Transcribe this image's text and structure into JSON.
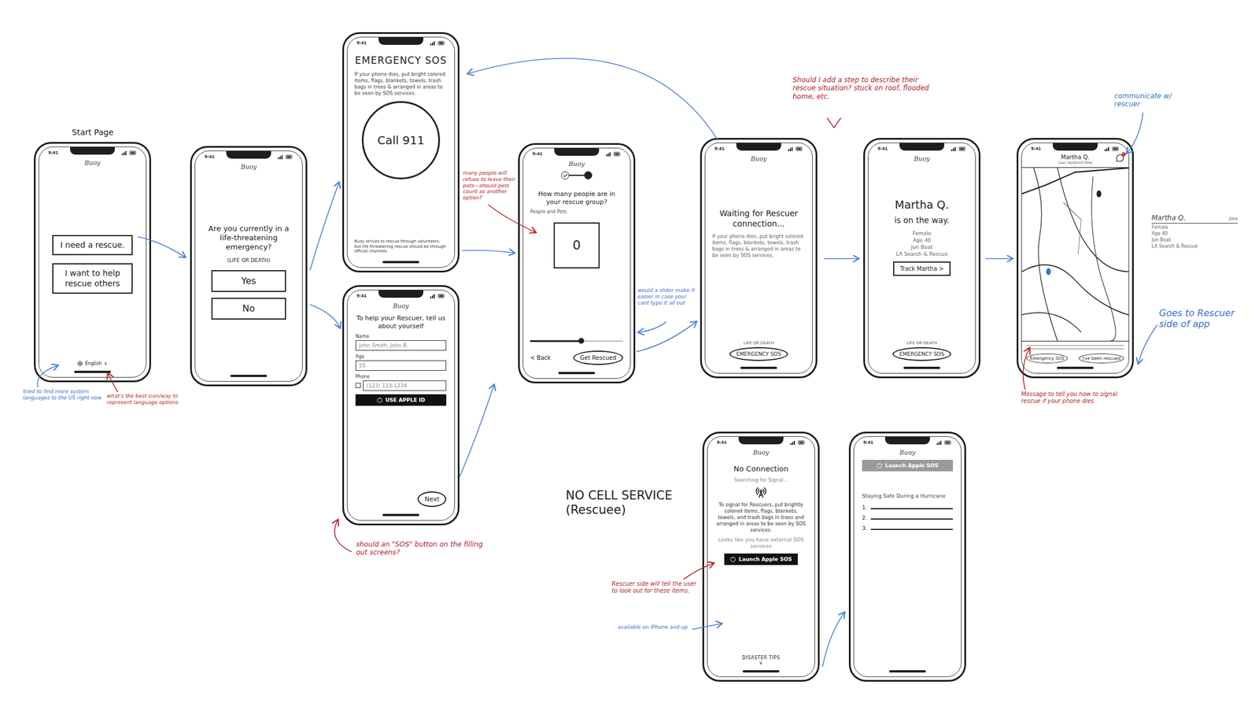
{
  "labels": {
    "start_page": "Start Page",
    "no_cell_service": "NO CELL SERVICE",
    "no_cell_service_sub": "(Rescuee)"
  },
  "status_time": "9:41",
  "app_name": "Buoy",
  "start": {
    "buttons": [
      "I need a rescue.",
      "I want to help rescue others"
    ],
    "language": "English",
    "language_caret": "∨"
  },
  "emergency_check": {
    "question": "Are you currently in a life-threatening emergency?",
    "note": "(LIFE OR DEATH)",
    "options": [
      "Yes",
      "No"
    ]
  },
  "emergency_sos": {
    "title": "EMERGENCY SOS",
    "tip": "If your phone dies, put bright colored items, flags, blankets, towels, trash bags in trees & arranged in areas to be seen by SOS services.",
    "call": "Call 911",
    "fine_print": "Buoy strives to rescue through volunteers, but life threatening rescue should be through official channels."
  },
  "about_you": {
    "heading": "To help your Rescuer, tell us about yourself",
    "fields": [
      {
        "label": "Name",
        "value": "John Smith, John B."
      },
      {
        "label": "Age",
        "value": "55"
      },
      {
        "label": "Phone",
        "value": "(123) 123-1234"
      }
    ],
    "apple_id": "USE APPLE ID",
    "next": "Next"
  },
  "group": {
    "steps": [
      {
        "done": true,
        "selected": false
      },
      {
        "done": false,
        "selected": true
      }
    ],
    "question": "How many people are in your rescue group?",
    "sub": "People and Pets",
    "count": "0",
    "slider": {
      "level": 0.55
    },
    "back": "< Back",
    "submit": "Get Rescued"
  },
  "waiting": {
    "heading": "Waiting for Rescuer connection...",
    "tip": "If your phone dies, put bright colored items, flags, blankets, towels, trash bags in trees & arranged in areas to be seen by SOS services.",
    "sos_note": "LIFE OR DEATH",
    "sos": "EMERGENCY SOS"
  },
  "rescuer_coming": {
    "name": "Martha Q.",
    "status": "is on the way.",
    "details": [
      "Female",
      "Age 40",
      "Jon Boat",
      "LA Search & Rescue"
    ],
    "track": "Track Martha >",
    "sos_note": "LIFE OR DEATH",
    "sos": "EMERGENCY SOS"
  },
  "tracking": {
    "name": "Martha Q.",
    "updated": "Last Updated Now",
    "buttons": [
      "Emergency SOS",
      "I've been rescued"
    ]
  },
  "rescuer_card": {
    "name": "Martha Q.",
    "time": "2hrs",
    "details": [
      "Female",
      "Age 40",
      "Jon Boat",
      "LA Search & Rescue"
    ]
  },
  "no_connection": {
    "heading": "No Connection",
    "searching": "Searching for Signal...",
    "tip": "To signal for Rescuers, put brightly colored items, flags, blankets, towels, and trash bags in trees and arranged in areas to be seen by SOS services.",
    "external": "Looks like you have external SOS services",
    "launch": "Launch Apple SOS",
    "tips": "DISASTER TIPS",
    "tips_caret": "∨"
  },
  "disaster_tips": {
    "banner": "Launch Apple SOS",
    "heading": "Staying Safe During a Hurricane",
    "items": [
      "1.",
      "2.",
      "3."
    ]
  },
  "annotations": {
    "language_systems": {
      "text": "tried to find more system languages to the US right now",
      "color": "#3b6fd1"
    },
    "language_icon": {
      "text": "what's the best icon/way to represent language options",
      "color": "#b3262b"
    },
    "pets": {
      "text": "many people will refuse to leave their pets—should pets count as another option?",
      "color": "#b3262b"
    },
    "slider": {
      "text": "would a slider make it easier in case your cant type it all out",
      "color": "#3b6fd1"
    },
    "sos_button": {
      "text": "should an \"SOS\" button on the filling out screens?",
      "color": "#b3262b"
    },
    "rescue_situation": {
      "text": "Should I add a step to describe their rescue situation? stuck on roof, flooded home, etc.",
      "color": "#b3262b"
    },
    "communicate": {
      "text": "communicate w/ rescuer",
      "color": "#3b6fd1"
    },
    "rescuer_side": {
      "text": "Goes to Rescuer side of app",
      "color": "#3b6fd1"
    },
    "signal_message": {
      "text": "Message to tell you how to signal rescue if your phone dies",
      "color": "#b3262b"
    },
    "look_out": {
      "text": "Rescuer side will tell the user to look out for these items.",
      "color": "#b3262b"
    },
    "apple_sos": {
      "text": "available on iPhone and up",
      "color": "#3b6fd1"
    }
  }
}
